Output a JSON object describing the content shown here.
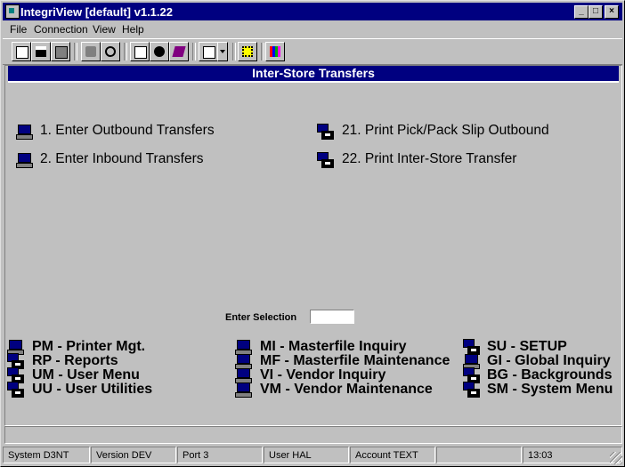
{
  "window": {
    "title": "IntegriView [default]  v1.1.22",
    "buttons": [
      "_",
      "□",
      "×"
    ]
  },
  "menu": [
    {
      "label": "File",
      "key": "F"
    },
    {
      "label": "Connection",
      "key": "C"
    },
    {
      "label": "View",
      "key": "V"
    },
    {
      "label": "Help",
      "key": "H"
    }
  ],
  "toolbar": {
    "icons": [
      "copy-icon",
      "save-icon",
      "print-icon",
      "lock-icon",
      "speaker-icon",
      "properties-icon",
      "monitor-icon",
      "book-icon",
      "clipboard-icon",
      "dropdown-icon",
      "tree-icon",
      "chart-icon"
    ]
  },
  "screen": {
    "header": "Inter-Store Transfers",
    "options_left": [
      "1. Enter Outbound Transfers",
      "2. Enter Inbound Transfers"
    ],
    "options_right": [
      "21. Print Pick/Pack Slip Outbound",
      "22. Print Inter-Store Transfer"
    ],
    "enter_selection_label": "Enter Selection",
    "enter_selection_value": ""
  },
  "shortcuts": {
    "col1": [
      "PM - Printer Mgt.",
      "RP - Reports",
      "UM - User Menu",
      "UU - User Utilities"
    ],
    "col2": [
      "MI - Masterfile Inquiry",
      "MF - Masterfile Maintenance",
      "VI - Vendor Inquiry",
      "VM - Vendor Maintenance"
    ],
    "col3": [
      "SU - SETUP",
      "GI - Global Inquiry",
      "BG - Backgrounds",
      "SM - System Menu"
    ]
  },
  "statusbar": [
    "System D3NT",
    "Version DEV",
    "Port 3",
    "User HAL",
    "Account TEXT",
    "",
    "13:03"
  ]
}
